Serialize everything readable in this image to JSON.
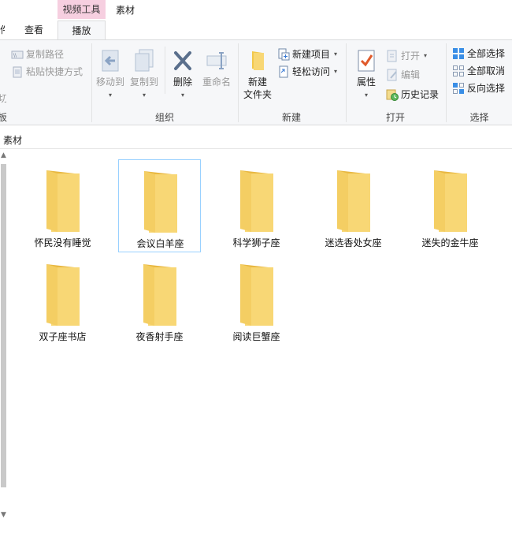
{
  "window": {
    "title": "素材",
    "context_tab": "视频工具"
  },
  "tabs": {
    "cut_tab": "件",
    "view": "查看",
    "play": "播放"
  },
  "ribbon": {
    "clipboard": {
      "copy_path": "复制路径",
      "paste_shortcut": "粘贴快捷方式",
      "cut_partial": "切",
      "group_partial": "板"
    },
    "organize": {
      "move_to": "移动到",
      "copy_to": "复制到",
      "delete": "删除",
      "rename": "重命名",
      "label": "组织"
    },
    "new": {
      "new_folder_line1": "新建",
      "new_folder_line2": "文件夹",
      "new_item": "新建项目",
      "easy_access": "轻松访问",
      "label": "新建"
    },
    "open": {
      "properties": "属性",
      "open": "打开",
      "edit": "编辑",
      "history": "历史记录",
      "label": "打开"
    },
    "select": {
      "select_all": "全部选择",
      "select_none": "全部取消",
      "invert": "反向选择",
      "label": "选择"
    }
  },
  "address": {
    "path": "素材"
  },
  "folders": [
    {
      "name": "怀民没有睡觉",
      "selected": false
    },
    {
      "name": "会议白羊座",
      "selected": true
    },
    {
      "name": "科学狮子座",
      "selected": false
    },
    {
      "name": "迷选香处女座",
      "selected": false
    },
    {
      "name": "迷失的金牛座",
      "selected": false
    },
    {
      "name": "双子座书店",
      "selected": false
    },
    {
      "name": "夜香射手座",
      "selected": false
    },
    {
      "name": "阅读巨蟹座",
      "selected": false
    }
  ],
  "colors": {
    "context_tab": "#f6cfe0",
    "selection_border": "#99d1ff",
    "folder": "#f8d775"
  }
}
